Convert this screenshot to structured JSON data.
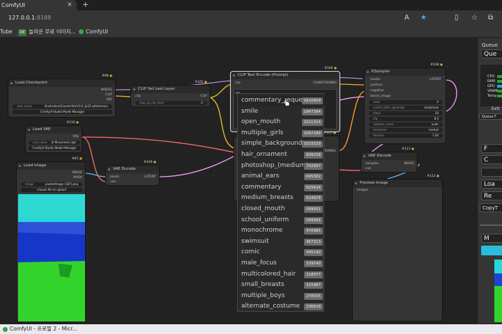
{
  "browser": {
    "tab_title": "ComfyUI",
    "tab_close": "×",
    "new_tab": "+",
    "url_host": "127.0.0.1",
    "url_port": ":8188",
    "bookmarks": [
      {
        "label": "Tube"
      },
      {
        "badge": "DE",
        "label": "놀라운 무료 이미지..."
      },
      {
        "label": "ComfyUI"
      }
    ]
  },
  "nodes": {
    "load_checkpoint": {
      "id": "#98",
      "title": "Load Checkpoint",
      "outputs": [
        "MODEL",
        "CLIP",
        "VAE"
      ],
      "ckpt_label": "ckpt_name",
      "ckpt_value": "Illustration\\Counterfeit-V3.0_fp32.safetensors",
      "manager": "ComfyUI-Studio Model Manager"
    },
    "clip_set_last": {
      "id": "#105",
      "title": "CLIP Set Last Layer",
      "input": "clip",
      "output": "CLIP",
      "widget_label": "stop_at_clip_layer",
      "widget_value": "-2"
    },
    "load_vae": {
      "id": "#110",
      "title": "Load VAE",
      "output": "VAE",
      "vae_label": "vae_name",
      "vae_value": "kl-f8-anime2.ckpt",
      "manager": "ComfyUI-Studio Model Manager"
    },
    "load_image": {
      "id": "#87",
      "title": "Load Image",
      "outputs": [
        "IMAGE",
        "MASK"
      ],
      "image_label": "image",
      "image_value": "pastedImage (187).png",
      "upload": "choose file to upload"
    },
    "vae_encode": {
      "id": "#109",
      "title": "VAE Encode",
      "inputs": [
        "pixels",
        "vae"
      ],
      "output": "LATENT"
    },
    "clip_text": {
      "id": "#104",
      "title": "CLIP Text Encode (Prompt)",
      "input": "clip",
      "output": "CONDITIONING",
      "text": "co"
    },
    "ksampler": {
      "id": "#108",
      "title": "KSampler",
      "inputs": [
        "model",
        "positive",
        "negative",
        "latent_image"
      ],
      "output": "LATENT",
      "widgets": [
        {
          "label": "seed",
          "value": "0"
        },
        {
          "label": "control_after_generate",
          "value": "randomize"
        },
        {
          "label": "steps",
          "value": "20"
        },
        {
          "label": "cfg",
          "value": "8.0"
        },
        {
          "label": "sampler_name",
          "value": "euler"
        },
        {
          "label": "scheduler",
          "value": "normal"
        },
        {
          "label": "denoise",
          "value": "1.00"
        }
      ]
    },
    "clip_neg": {
      "id": "#107",
      "output": "CONDITIONING"
    },
    "vae_decode": {
      "id": "#111",
      "title": "VAE Decode",
      "inputs": [
        "samples",
        "vae"
      ],
      "output": "IMAGE"
    },
    "preview": {
      "id": "#112",
      "title": "Preview Image",
      "input": "images"
    }
  },
  "autocomplete": [
    {
      "tag": "commentary_request",
      "count": "2810959"
    },
    {
      "tag": "smile",
      "count": "1847264"
    },
    {
      "tag": "open_mouth",
      "count": "1521316"
    },
    {
      "tag": "multiple_girls",
      "count": "1097189"
    },
    {
      "tag": "simple_background",
      "count": "1033329"
    },
    {
      "tag": "hair_ornament",
      "count": "809258"
    },
    {
      "tag": "photoshop_(medium)",
      "count": "702997"
    },
    {
      "tag": "animal_ears",
      "count": "695302"
    },
    {
      "tag": "commentary",
      "count": "625624"
    },
    {
      "tag": "medium_breasts",
      "count": "624978"
    },
    {
      "tag": "closed_mouth",
      "count": "589051"
    },
    {
      "tag": "school_uniform",
      "count": "569565"
    },
    {
      "tag": "monochrome",
      "count": "470985"
    },
    {
      "tag": "swimsuit",
      "count": "457313"
    },
    {
      "tag": "comic",
      "count": "405140"
    },
    {
      "tag": "male_focus",
      "count": "339240"
    },
    {
      "tag": "multicolored_hair",
      "count": "318977"
    },
    {
      "tag": "small_breasts",
      "count": "315987"
    },
    {
      "tag": "multiple_boys",
      "count": "278555"
    },
    {
      "tag": "alternate_costume",
      "count": "236618"
    }
  ],
  "panel": {
    "header": "Queue",
    "queue_btn": "Que",
    "stats": [
      "CPU",
      "RAM",
      "GPU",
      "VRAM",
      "Temp"
    ],
    "extra": "Extr",
    "queue_front": "Queue F",
    "buttons": [
      "F",
      "C",
      "",
      "Loa",
      "Re",
      "CopyT"
    ],
    "m_btn": "M"
  },
  "taskbar": {
    "label": "ComfyUI - 프로필 2 - Micr..."
  },
  "colors": {
    "clip_wire": "#f1c230",
    "model_wire": "#b38bd6",
    "vae_wire": "#ff6e6e",
    "latent_wire": "#ff9cf9",
    "cond_wire": "#ffa931",
    "image_wire": "#64b5f6"
  }
}
